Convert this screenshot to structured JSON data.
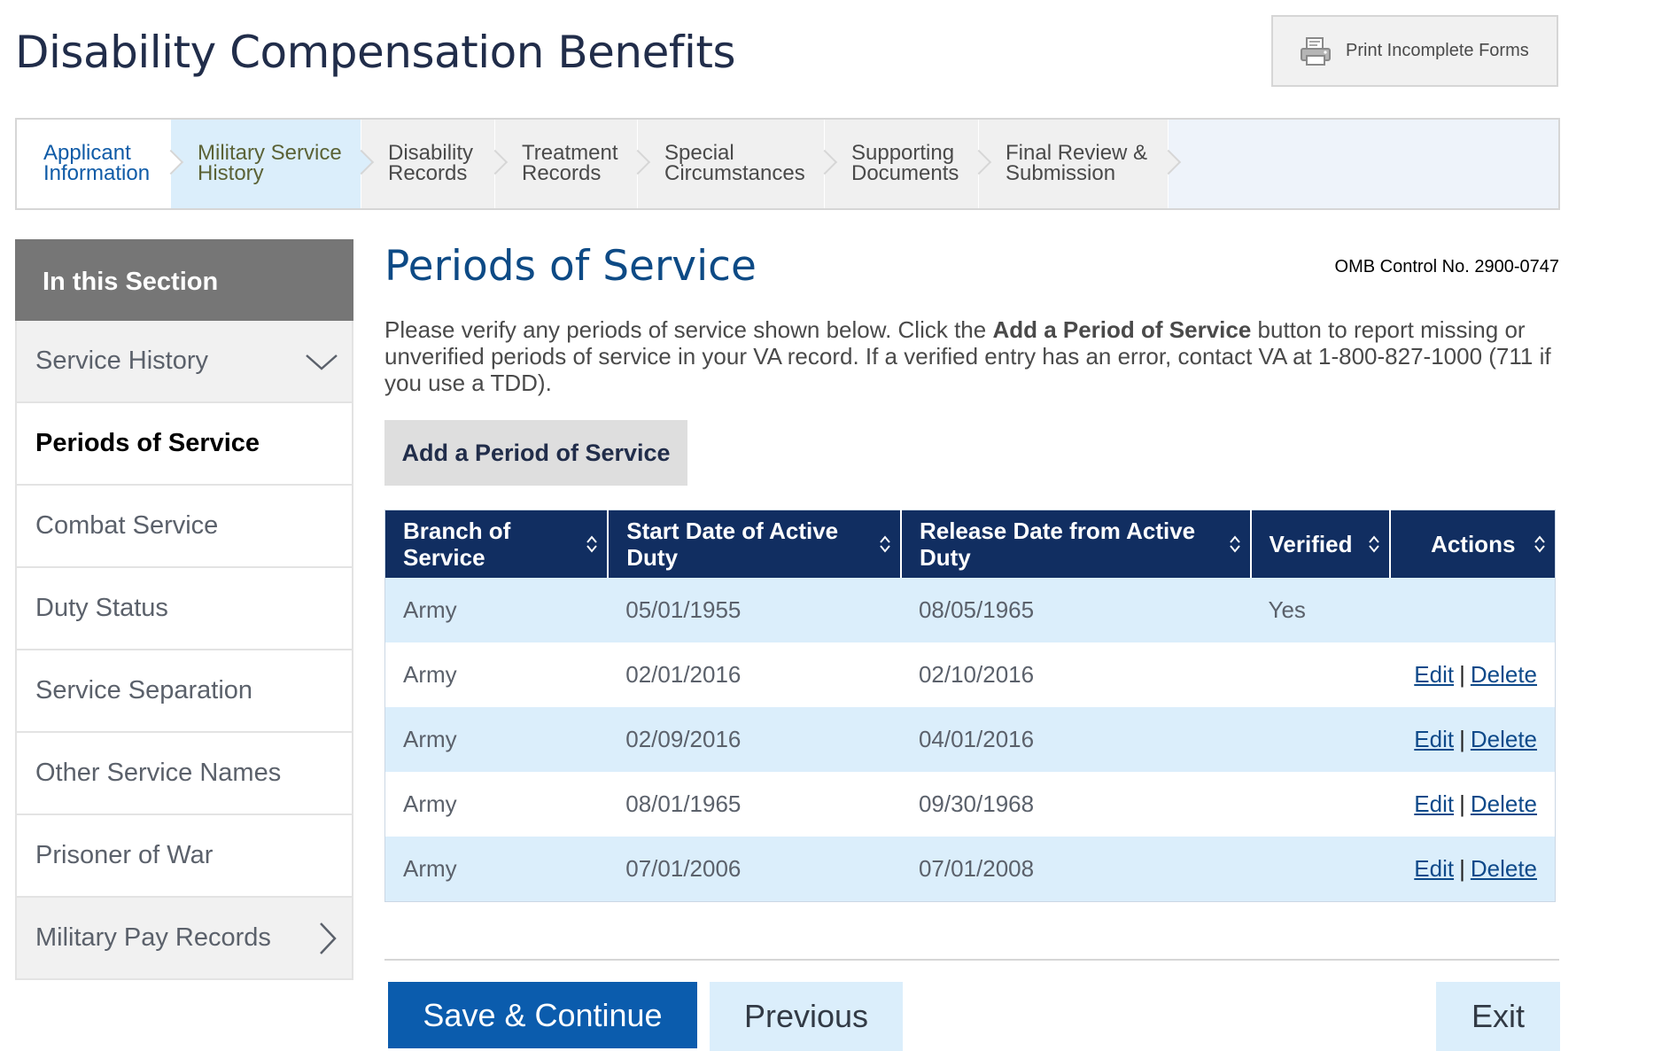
{
  "header": {
    "title": "Disability Compensation Benefits",
    "print_button": {
      "label": "Print Incomplete Forms",
      "icon": "printer-icon"
    }
  },
  "tabs": [
    {
      "label_line1": "Applicant",
      "label_line2": "Information",
      "state": "active"
    },
    {
      "label_line1": "Military Service",
      "label_line2": "History",
      "state": "current"
    },
    {
      "label_line1": "Disability",
      "label_line2": "Records",
      "state": "default"
    },
    {
      "label_line1": "Treatment",
      "label_line2": "Records",
      "state": "default"
    },
    {
      "label_line1": "Special",
      "label_line2": "Circumstances",
      "state": "default"
    },
    {
      "label_line1": "Supporting",
      "label_line2": "Documents",
      "state": "default"
    },
    {
      "label_line1": "Final Review &",
      "label_line2": "Submission",
      "state": "default"
    }
  ],
  "sidebar": {
    "heading": "In this Section",
    "items": [
      {
        "label": "Service History",
        "icon": "chevron-down-icon"
      },
      {
        "label": "Periods of Service",
        "selected": true
      },
      {
        "label": "Combat Service"
      },
      {
        "label": "Duty Status"
      },
      {
        "label": "Service Separation"
      },
      {
        "label": "Other Service Names"
      },
      {
        "label": "Prisoner of War"
      },
      {
        "label": "Military Pay Records",
        "icon": "chevron-right-icon"
      }
    ]
  },
  "main": {
    "title": "Periods of Service",
    "omb": "OMB Control No. 2900-0747",
    "intro_part1": "Please verify any periods of service shown below. Click the ",
    "intro_bold": "Add a Period of Service",
    "intro_part2": " button to report missing or unverified periods of service in your VA record. If a verified entry has an error, contact VA at 1-800-827-1000 (711 if you use a TDD).",
    "add_button": "Add a Period of Service"
  },
  "table": {
    "columns": [
      {
        "line1": "Branch of",
        "line2": "Service"
      },
      {
        "line1": "Start Date of Active",
        "line2": "Duty"
      },
      {
        "line1": "Release Date from Active",
        "line2": "Duty"
      },
      {
        "line1": "Verified",
        "line2": ""
      },
      {
        "line1": "Actions",
        "line2": ""
      }
    ],
    "rows": [
      {
        "branch": "Army",
        "start": "05/01/1955",
        "release": "08/05/1965",
        "verified": "Yes",
        "edit": "",
        "sep": "",
        "delete": ""
      },
      {
        "branch": "Army",
        "start": "02/01/2016",
        "release": "02/10/2016",
        "verified": "",
        "edit": "Edit",
        "sep": "|",
        "delete": "Delete"
      },
      {
        "branch": "Army",
        "start": "02/09/2016",
        "release": "04/01/2016",
        "verified": "",
        "edit": "Edit",
        "sep": "|",
        "delete": "Delete"
      },
      {
        "branch": "Army",
        "start": "08/01/1965",
        "release": "09/30/1968",
        "verified": "",
        "edit": "Edit",
        "sep": "|",
        "delete": "Delete"
      },
      {
        "branch": "Army",
        "start": "07/01/2006",
        "release": "07/01/2008",
        "verified": "",
        "edit": "Edit",
        "sep": "|",
        "delete": "Delete"
      }
    ]
  },
  "footer": {
    "save": "Save & Continue",
    "previous": "Previous",
    "exit": "Exit"
  },
  "colors": {
    "primary": "#0b5cad",
    "header_navy": "#112e61",
    "row_tint": "#dbeefb",
    "title_navy": "#0d4a85"
  }
}
